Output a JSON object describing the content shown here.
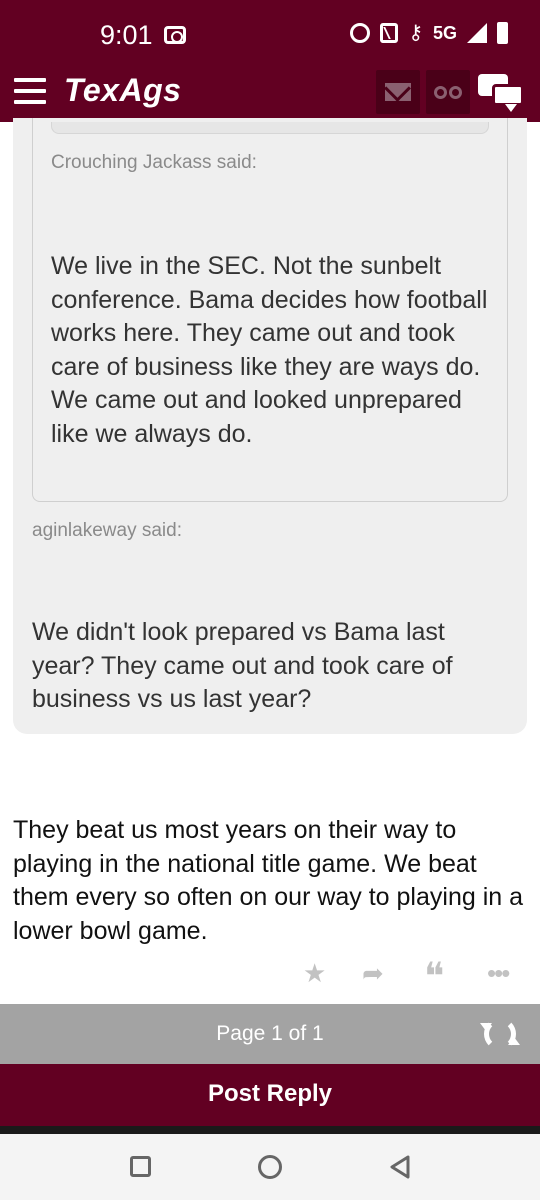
{
  "status_bar": {
    "time": "9:01",
    "network": "5G",
    "icons": [
      "screen-record-icon",
      "alarm-icon",
      "nfc-icon",
      "key-icon",
      "signal-icon",
      "battery-icon"
    ]
  },
  "header": {
    "logo": "TexAgs",
    "icons": [
      "menu-icon",
      "mail-icon",
      "binoculars-icon",
      "chat-icon"
    ],
    "brand_color": "#620022"
  },
  "quotes": {
    "nested": {
      "author_said": "Crouching Jackass said:",
      "text": "We live in the SEC. Not the sunbelt conference. Bama decides how football works here. They came out and took care of business like they are ways do. We came out and looked unprepared like we always do."
    },
    "outer": {
      "author_said": "aginlakeway said:",
      "text": "We didn't look prepared vs Bama last year? They came out and took care of business vs us last year?"
    }
  },
  "post": {
    "body": "They beat us most years on their way to playing in the national title game. We beat them every so often on our way to playing in a lower bowl game."
  },
  "post_actions": {
    "star": "★",
    "reply": "➦",
    "quote": "❝",
    "more": "•••"
  },
  "pagination": {
    "label": "Page 1 of 1"
  },
  "reply_button": {
    "label": "Post Reply"
  },
  "android_nav": [
    "recents-icon",
    "home-icon",
    "back-icon"
  ]
}
